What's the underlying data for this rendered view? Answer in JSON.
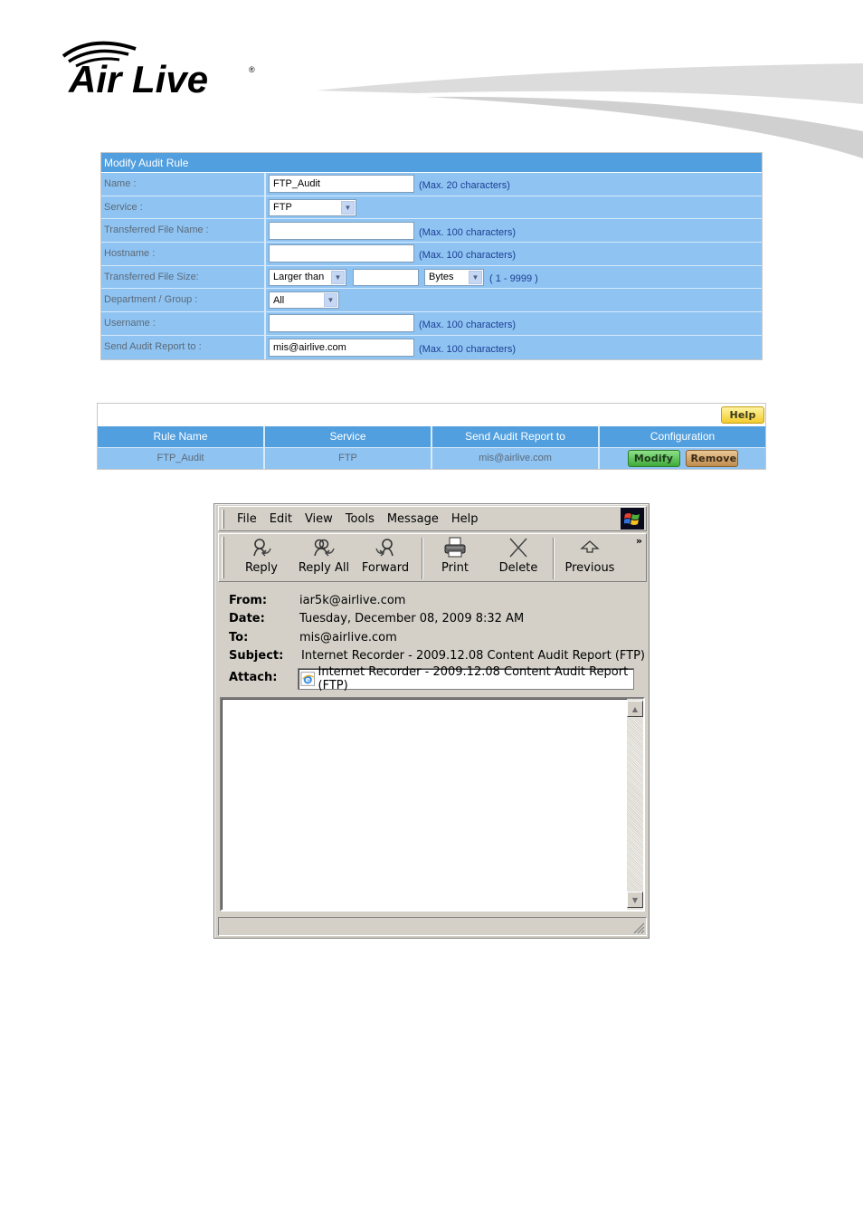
{
  "brand": {
    "logo_text": "Air Live",
    "registered_mark": "®"
  },
  "modify_form": {
    "title": "Modify Audit Rule",
    "rows": [
      {
        "label": "Name :",
        "value": "FTP_Audit",
        "hint": "(Max. 20 characters)"
      },
      {
        "label": "Service :",
        "selected": "FTP"
      },
      {
        "label": "Transferred File Name :",
        "value": "",
        "hint": "(Max. 100 characters)"
      },
      {
        "label": "Hostname :",
        "value": "",
        "hint": "(Max. 100 characters)"
      },
      {
        "label": "Transferred File Size:",
        "comparator": "Larger than",
        "value": "",
        "unit": "Bytes",
        "hint": "( 1 - 9999 )"
      },
      {
        "label": "Department / Group :",
        "selected": "All"
      },
      {
        "label": "Username :",
        "value": "",
        "hint": "(Max. 100 characters)"
      },
      {
        "label": "Send Audit Report to :",
        "value": "mis@airlive.com",
        "hint": "(Max. 100 characters)"
      }
    ]
  },
  "rules_table": {
    "help_label": "Help",
    "columns": [
      "Rule Name",
      "Service",
      "Send Audit Report to",
      "Configuration"
    ],
    "rows": [
      {
        "rule_name": "FTP_Audit",
        "service": "FTP",
        "report_to": "mis@airlive.com",
        "modify_label": "Modify",
        "remove_label": "Remove"
      }
    ]
  },
  "mail_window": {
    "menu": [
      "File",
      "Edit",
      "View",
      "Tools",
      "Message",
      "Help"
    ],
    "toolbar": [
      {
        "label": "Reply",
        "icon": "reply-icon"
      },
      {
        "label": "Reply All",
        "icon": "reply-all-icon"
      },
      {
        "label": "Forward",
        "icon": "forward-icon"
      },
      {
        "label": "Print",
        "icon": "print-icon"
      },
      {
        "label": "Delete",
        "icon": "delete-icon"
      },
      {
        "label": "Previous",
        "icon": "previous-icon"
      }
    ],
    "overflow_label": "»",
    "headers": {
      "from_label": "From:",
      "from": "iar5k@airlive.com",
      "date_label": "Date:",
      "date": "Tuesday, December 08, 2009 8:32 AM",
      "to_label": "To:",
      "to": "mis@airlive.com",
      "subject_label": "Subject:",
      "subject": "Internet Recorder - 2009.12.08 Content Audit Report (FTP)",
      "attach_label": "Attach:",
      "attachment": "Internet Recorder - 2009.12.08 Content Audit Report (FTP)"
    },
    "body": ""
  },
  "colors": {
    "header_blue": "#519fdf",
    "row_blue": "#8ec3f2",
    "hint_blue": "#1c3f94",
    "window_gray": "#d4d0c8"
  }
}
